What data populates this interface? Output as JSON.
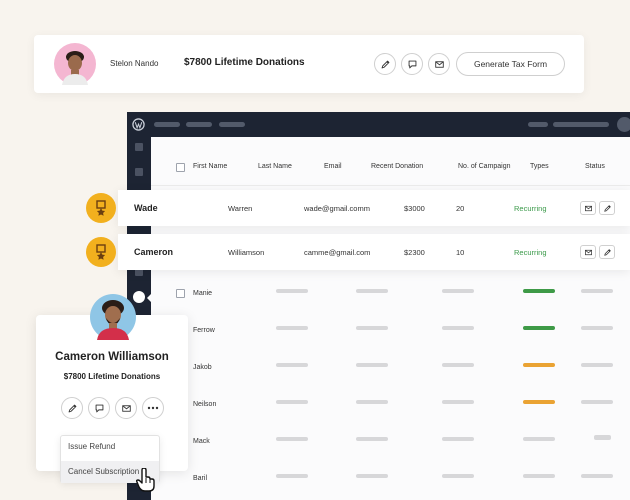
{
  "top_card": {
    "name": "Stelon Nando",
    "donations": "$7800 Lifetime Donations",
    "tax_button": "Generate Tax Form"
  },
  "table": {
    "headers": [
      "First Name",
      "Last Name",
      "Email",
      "Recent Donation",
      "No. of Campaign",
      "Types",
      "Status"
    ],
    "highlighted_rows": [
      {
        "first": "Wade",
        "last": "Warren",
        "email": "wade@gmail.comm",
        "donation": "$3000",
        "campaigns": "20",
        "type": "Recurring"
      },
      {
        "first": "Cameron",
        "last": "Williamson",
        "email": "camme@gmail.com",
        "donation": "$2300",
        "campaigns": "10",
        "type": "Recurring"
      }
    ],
    "faded_rows": [
      {
        "first": "Manie",
        "type_color": "green"
      },
      {
        "first": "Ferrow",
        "type_color": "green"
      },
      {
        "first": "Jakob",
        "type_color": "orange"
      },
      {
        "first": "Neilson",
        "type_color": "orange"
      },
      {
        "first": "Mack",
        "type_color": "gray"
      },
      {
        "first": "Baril",
        "type_color": "gray"
      }
    ]
  },
  "profile": {
    "name": "Cameron Williamson",
    "donations": "$7800 Lifetime Donations"
  },
  "menu": {
    "items": [
      "Issue Refund",
      "Cancel Subscription"
    ]
  },
  "icons": {
    "edit": "pencil-icon",
    "comment": "chat-icon",
    "mail": "mail-icon",
    "more": "more-icon",
    "logo": "wordpress-icon",
    "medal": "medal-icon"
  },
  "colors": {
    "admin_dark": "#1d2433",
    "recurring": "#3b9a4a",
    "medal": "#f2b01e",
    "green": "#3e9a47",
    "orange": "#eaa333"
  }
}
